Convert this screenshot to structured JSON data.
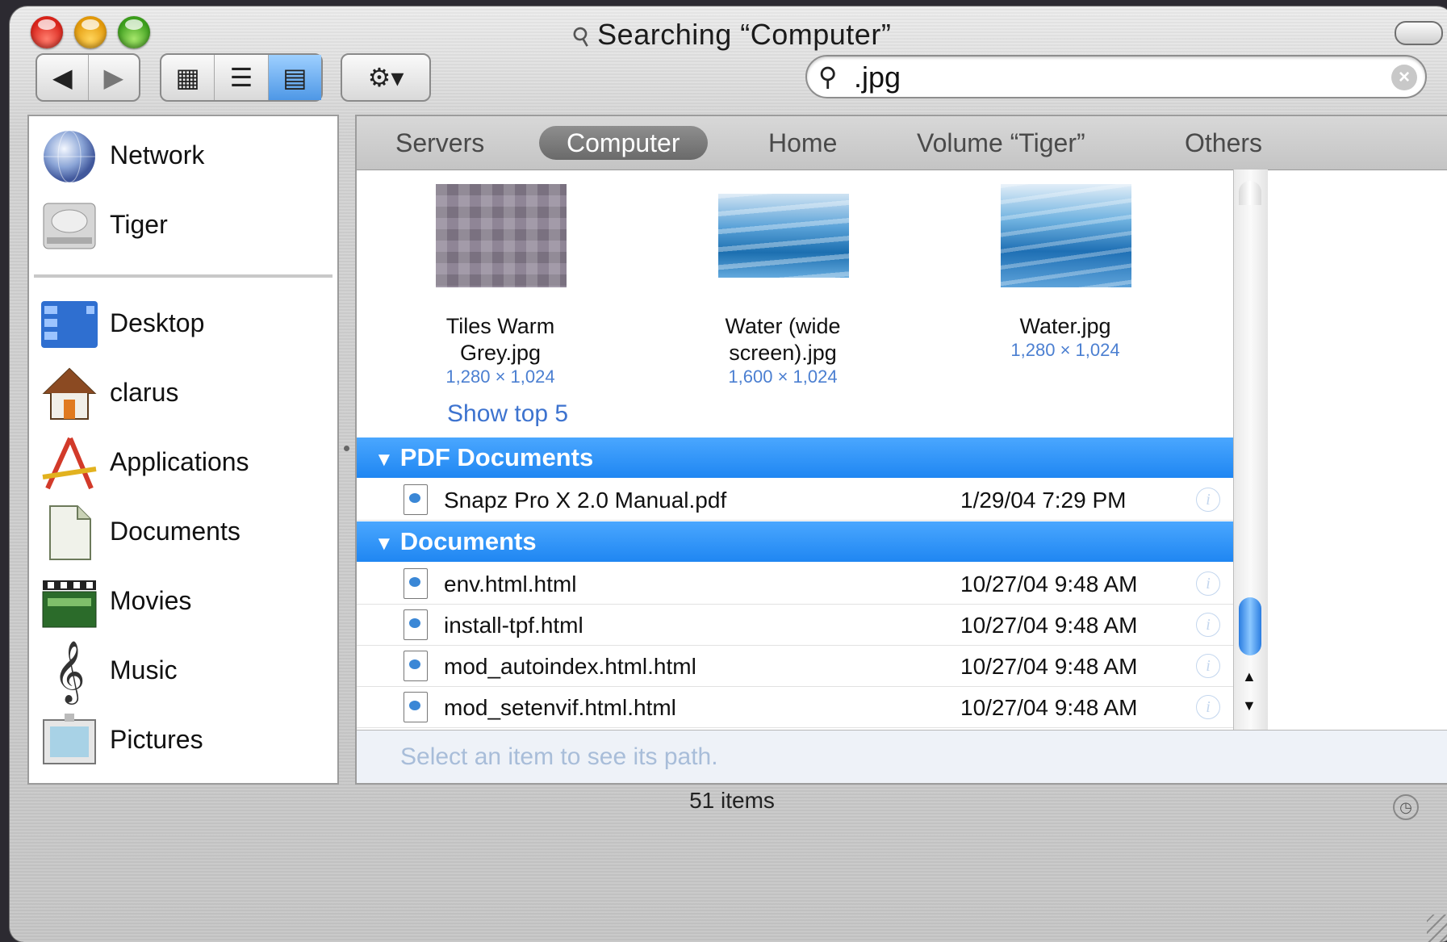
{
  "window": {
    "title": "Searching “Computer”",
    "title_icon": "magnifier-icon"
  },
  "toolbar": {
    "back_icon": "◀",
    "forward_icon": "▶",
    "view_icon": "▦",
    "list_view_icon": "☰",
    "column_view_icon": "▤",
    "action_icon": "⚙▾",
    "search_value": ".jpg",
    "search_icon": "🔍",
    "clear_icon": "×"
  },
  "sidebar": {
    "items": [
      {
        "label": "Network",
        "icon": "network-globe-icon"
      },
      {
        "label": "Tiger",
        "icon": "hard-disk-icon"
      },
      {
        "label": "Desktop",
        "icon": "desktop-icon"
      },
      {
        "label": "clarus",
        "icon": "home-icon"
      },
      {
        "label": "Applications",
        "icon": "applications-icon"
      },
      {
        "label": "Documents",
        "icon": "documents-folder-icon"
      },
      {
        "label": "Movies",
        "icon": "movies-icon"
      },
      {
        "label": "Music",
        "icon": "music-icon"
      },
      {
        "label": "Pictures",
        "icon": "pictures-icon"
      }
    ]
  },
  "scopes": {
    "servers": "Servers",
    "computer": "Computer",
    "home": "Home",
    "volume": "Volume “Tiger”",
    "others": "Others"
  },
  "images": [
    {
      "name": "Tiles Warm Grey.jpg",
      "dims": "1,280 × 1,024"
    },
    {
      "name_line1": "Water (wide",
      "name_line2": "screen).jpg",
      "dims": "1,600 × 1,024"
    },
    {
      "name": "Water.jpg",
      "dims": "1,280 × 1,024"
    }
  ],
  "show_top": "Show top 5",
  "groups": {
    "pdf": {
      "header": "PDF Documents",
      "rows": [
        {
          "name": "Snapz Pro X 2.0 Manual.pdf",
          "date": "1/29/04 7:29 PM"
        }
      ]
    },
    "docs": {
      "header": "Documents",
      "rows": [
        {
          "name": "env.html.html",
          "date": "10/27/04 9:48 AM"
        },
        {
          "name": "install-tpf.html",
          "date": "10/27/04 9:48 AM"
        },
        {
          "name": "mod_autoindex.html.html",
          "date": "10/27/04 9:48 AM"
        },
        {
          "name": "mod_setenvif.html.html",
          "date": "10/27/04 9:48 AM"
        }
      ]
    }
  },
  "pathbar": "Select an item to see its path.",
  "status": "51 items",
  "colors": {
    "group_header": "#1f86f2",
    "link_blue": "#3d73cf"
  }
}
